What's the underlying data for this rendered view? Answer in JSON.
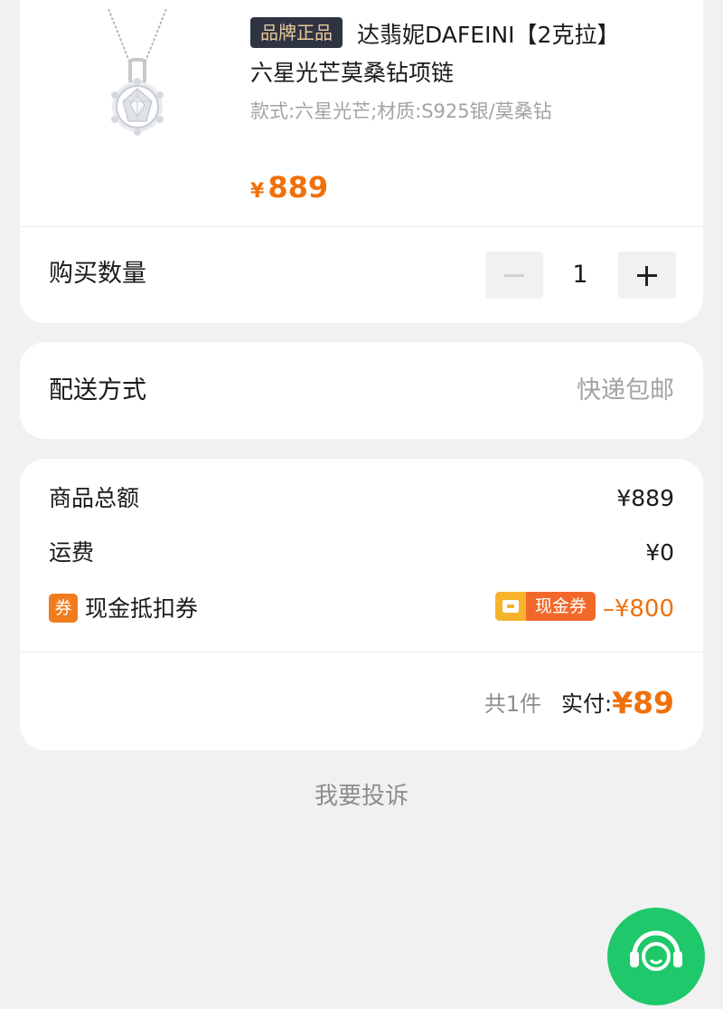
{
  "product": {
    "brand_tag": "品牌正品",
    "title_line1": "达翡妮DAFEINI【2克拉】",
    "title_line2": "六星光芒莫桑钻项链",
    "spec": "款式:六星光芒;材质:S925银/莫桑钻",
    "price_symbol": "¥",
    "price": "889",
    "image_icon": "diamond-necklace-image"
  },
  "quantity": {
    "label": "购买数量",
    "value": "1"
  },
  "delivery": {
    "label": "配送方式",
    "value": "快递包邮"
  },
  "summary": {
    "subtotal_label": "商品总额",
    "subtotal_value": "¥889",
    "shipping_label": "运费",
    "shipping_value": "¥0",
    "coupon_badge": "券",
    "coupon_label": "现金抵扣券",
    "cash_coupon_tag": "现金券",
    "discount_value": "–¥800",
    "total_count": "共1件",
    "total_label": "实付:",
    "total_value": "¥89"
  },
  "complaint": {
    "label": "我要投诉"
  },
  "colors": {
    "accent": "#f0700a",
    "brand_tag_bg": "#2f3442",
    "brand_tag_text": "#e8c99a",
    "service_green": "#1fc86a",
    "muted_text": "#a3a3a3"
  }
}
